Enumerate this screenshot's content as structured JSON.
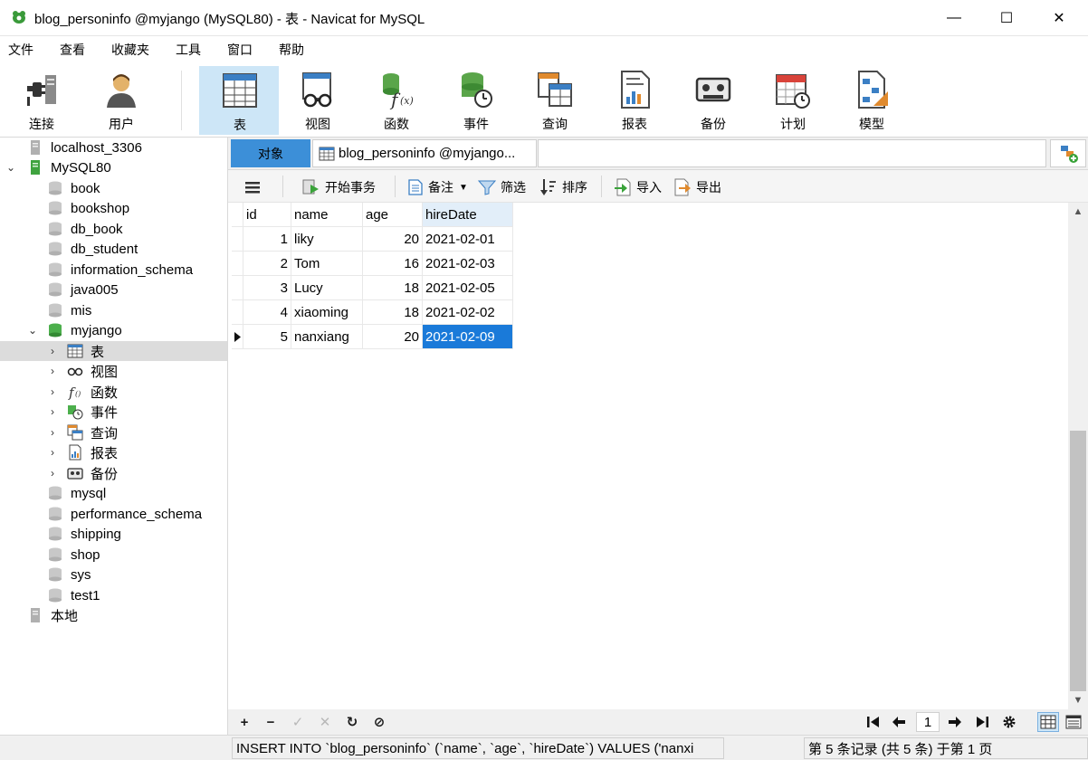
{
  "window": {
    "title": "blog_personinfo @myjango (MySQL80) - 表 - Navicat for MySQL",
    "minimize": "—",
    "maximize": "☐",
    "close": "✕"
  },
  "menu": [
    "文件",
    "查看",
    "收藏夹",
    "工具",
    "窗口",
    "帮助"
  ],
  "toolbar": {
    "connect": "连接",
    "user": "用户",
    "table": "表",
    "view": "视图",
    "function": "函数",
    "event": "事件",
    "query": "查询",
    "report": "报表",
    "backup": "备份",
    "schedule": "计划",
    "model": "模型"
  },
  "sidebar": {
    "nodes": [
      "localhost_3306",
      "MySQL80",
      "book",
      "bookshop",
      "db_book",
      "db_student",
      "information_schema",
      "java005",
      "mis",
      "myjango",
      "表",
      "视图",
      "函数",
      "事件",
      "查询",
      "报表",
      "备份",
      "mysql",
      "performance_schema",
      "shipping",
      "shop",
      "sys",
      "test1",
      "本地"
    ]
  },
  "tabs": {
    "objects": "对象",
    "doc": "blog_personinfo @myjango..."
  },
  "actions": {
    "begin_transaction": "开始事务",
    "memo": "备注",
    "filter": "筛选",
    "sort": "排序",
    "import": "导入",
    "export": "导出"
  },
  "grid": {
    "columns": [
      "id",
      "name",
      "age",
      "hireDate"
    ],
    "rows": [
      [
        "1",
        "liky",
        "20",
        "2021-02-01"
      ],
      [
        "2",
        "Tom",
        "16",
        "2021-02-03"
      ],
      [
        "3",
        "Lucy",
        "18",
        "2021-02-05"
      ],
      [
        "4",
        "xiaoming",
        "18",
        "2021-02-02"
      ],
      [
        "5",
        "nanxiang",
        "20",
        "2021-02-09"
      ]
    ]
  },
  "nav": {
    "add": "+",
    "delete": "−",
    "apply": "✓",
    "discard": "✕",
    "refresh": "↻",
    "stop": "⊘",
    "page": "1"
  },
  "status": {
    "sql": "INSERT INTO `blog_personinfo` (`name`, `age`, `hireDate`) VALUES ('nanxi",
    "records": "第 5 条记录 (共 5 条) 于第 1 页"
  }
}
